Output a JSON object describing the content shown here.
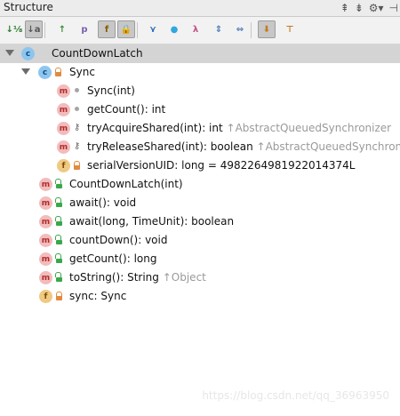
{
  "panel": {
    "title": "Structure",
    "title_icons": [
      "align-top-icon",
      "align-center-icon",
      "gear-icon",
      "hide-icon"
    ]
  },
  "toolbar": {
    "buttons": [
      {
        "name": "sort-by-visibility",
        "glyph": "↓⅛",
        "active": false
      },
      {
        "name": "sort-alphabetically",
        "glyph": "↓a",
        "active": true
      },
      {
        "name": "show-inherited",
        "glyph": "↑",
        "active": false
      },
      {
        "name": "show-properties",
        "glyph": "p",
        "active": false
      },
      {
        "name": "show-fields",
        "glyph": "f",
        "active": true
      },
      {
        "name": "show-non-public",
        "glyph": "🔒",
        "active": true
      },
      {
        "name": "show-anonymous",
        "glyph": "⋎",
        "active": false
      },
      {
        "name": "show-lambdas-circle",
        "glyph": "●",
        "active": false
      },
      {
        "name": "show-lambdas",
        "glyph": "λ",
        "active": false
      },
      {
        "name": "expand-all",
        "glyph": "⇕",
        "active": false
      },
      {
        "name": "collapse-all",
        "glyph": "⇔",
        "active": false
      },
      {
        "name": "autoscroll-to-source",
        "glyph": "⬇",
        "active": true
      },
      {
        "name": "autoscroll-from-source",
        "glyph": "⊤",
        "active": false
      }
    ]
  },
  "tree": {
    "root": {
      "label": "CountDownLatch"
    },
    "sync_class": {
      "label": "Sync"
    },
    "sync_members": [
      {
        "label": "Sync(int)",
        "kind": "m",
        "vis": "package",
        "inherit": ""
      },
      {
        "label": "getCount(): int",
        "kind": "m",
        "vis": "package",
        "inherit": ""
      },
      {
        "label": "tryAcquireShared(int): int",
        "kind": "m",
        "vis": "protected",
        "inherit": "↑AbstractQueuedSynchronizer"
      },
      {
        "label": "tryReleaseShared(int): boolean",
        "kind": "m",
        "vis": "protected",
        "inherit": "↑AbstractQueuedSynchronize"
      },
      {
        "label": "serialVersionUID: long = 4982264981922014374L",
        "kind": "f",
        "vis": "private",
        "inherit": ""
      }
    ],
    "members": [
      {
        "label": "CountDownLatch(int)",
        "kind": "m",
        "vis": "public",
        "inherit": ""
      },
      {
        "label": "await(): void",
        "kind": "m",
        "vis": "public",
        "inherit": ""
      },
      {
        "label": "await(long, TimeUnit): boolean",
        "kind": "m",
        "vis": "public",
        "inherit": ""
      },
      {
        "label": "countDown(): void",
        "kind": "m",
        "vis": "public",
        "inherit": ""
      },
      {
        "label": "getCount(): long",
        "kind": "m",
        "vis": "public",
        "inherit": ""
      },
      {
        "label": "toString(): String",
        "kind": "m",
        "vis": "public",
        "inherit": "↑Object"
      },
      {
        "label": "sync: Sync",
        "kind": "f",
        "vis": "private",
        "inherit": ""
      }
    ]
  },
  "watermark": "https://blog.csdn.net/qq_36963950"
}
